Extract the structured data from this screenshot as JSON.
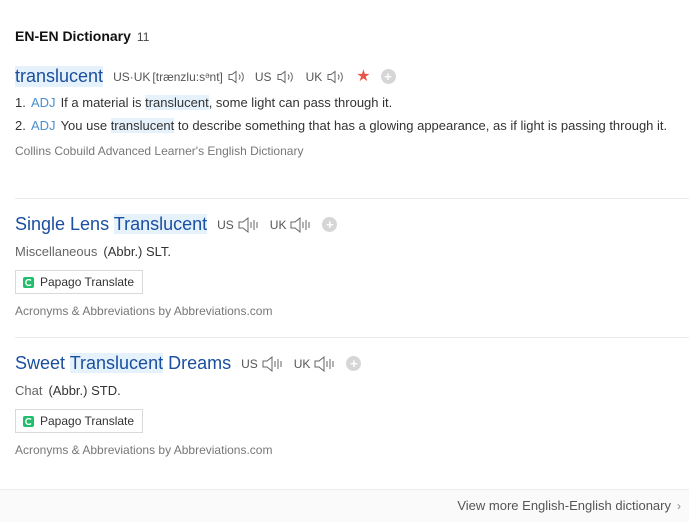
{
  "header": {
    "title": "EN-EN Dictionary",
    "count": "11"
  },
  "entries": [
    {
      "word": "translucent",
      "pron": {
        "us_uk_label": "US·UK",
        "ipa": "[trænzlu:sᵊnt]",
        "us_label": "US",
        "uk_label": "UK"
      },
      "favorite_icon": "star-icon",
      "senses": [
        {
          "num": "1.",
          "pos": "ADJ",
          "pre": "If a material is ",
          "hl": "translucent",
          "post": ", some light can pass through it."
        },
        {
          "num": "2.",
          "pos": "ADJ",
          "pre": "You use ",
          "hl": "translucent",
          "post": " to describe something that has a glowing appearance, as if light is passing through it."
        }
      ],
      "source": "Collins Cobuild Advanced Learner's English Dictionary"
    },
    {
      "word_pre": "Single Lens ",
      "word_hl": "Translucent",
      "word_post": "",
      "us_label": "US",
      "uk_label": "UK",
      "category": "Miscellaneous",
      "definition": "(Abbr.) SLT.",
      "papago_label": "Papago Translate",
      "source": "Acronyms & Abbreviations by Abbreviations.com"
    },
    {
      "word_pre": "Sweet ",
      "word_hl": "Translucent",
      "word_post": " Dreams",
      "us_label": "US",
      "uk_label": "UK",
      "category": "Chat",
      "definition": "(Abbr.) STD.",
      "papago_label": "Papago Translate",
      "source": "Acronyms & Abbreviations by Abbreviations.com"
    }
  ],
  "footer": {
    "more_label": "View more English-English dictionary"
  },
  "colors": {
    "link": "#1a4fa0",
    "highlight": "#e6f2fb",
    "star": "#e8564b",
    "papago": "#1fbf6b"
  }
}
